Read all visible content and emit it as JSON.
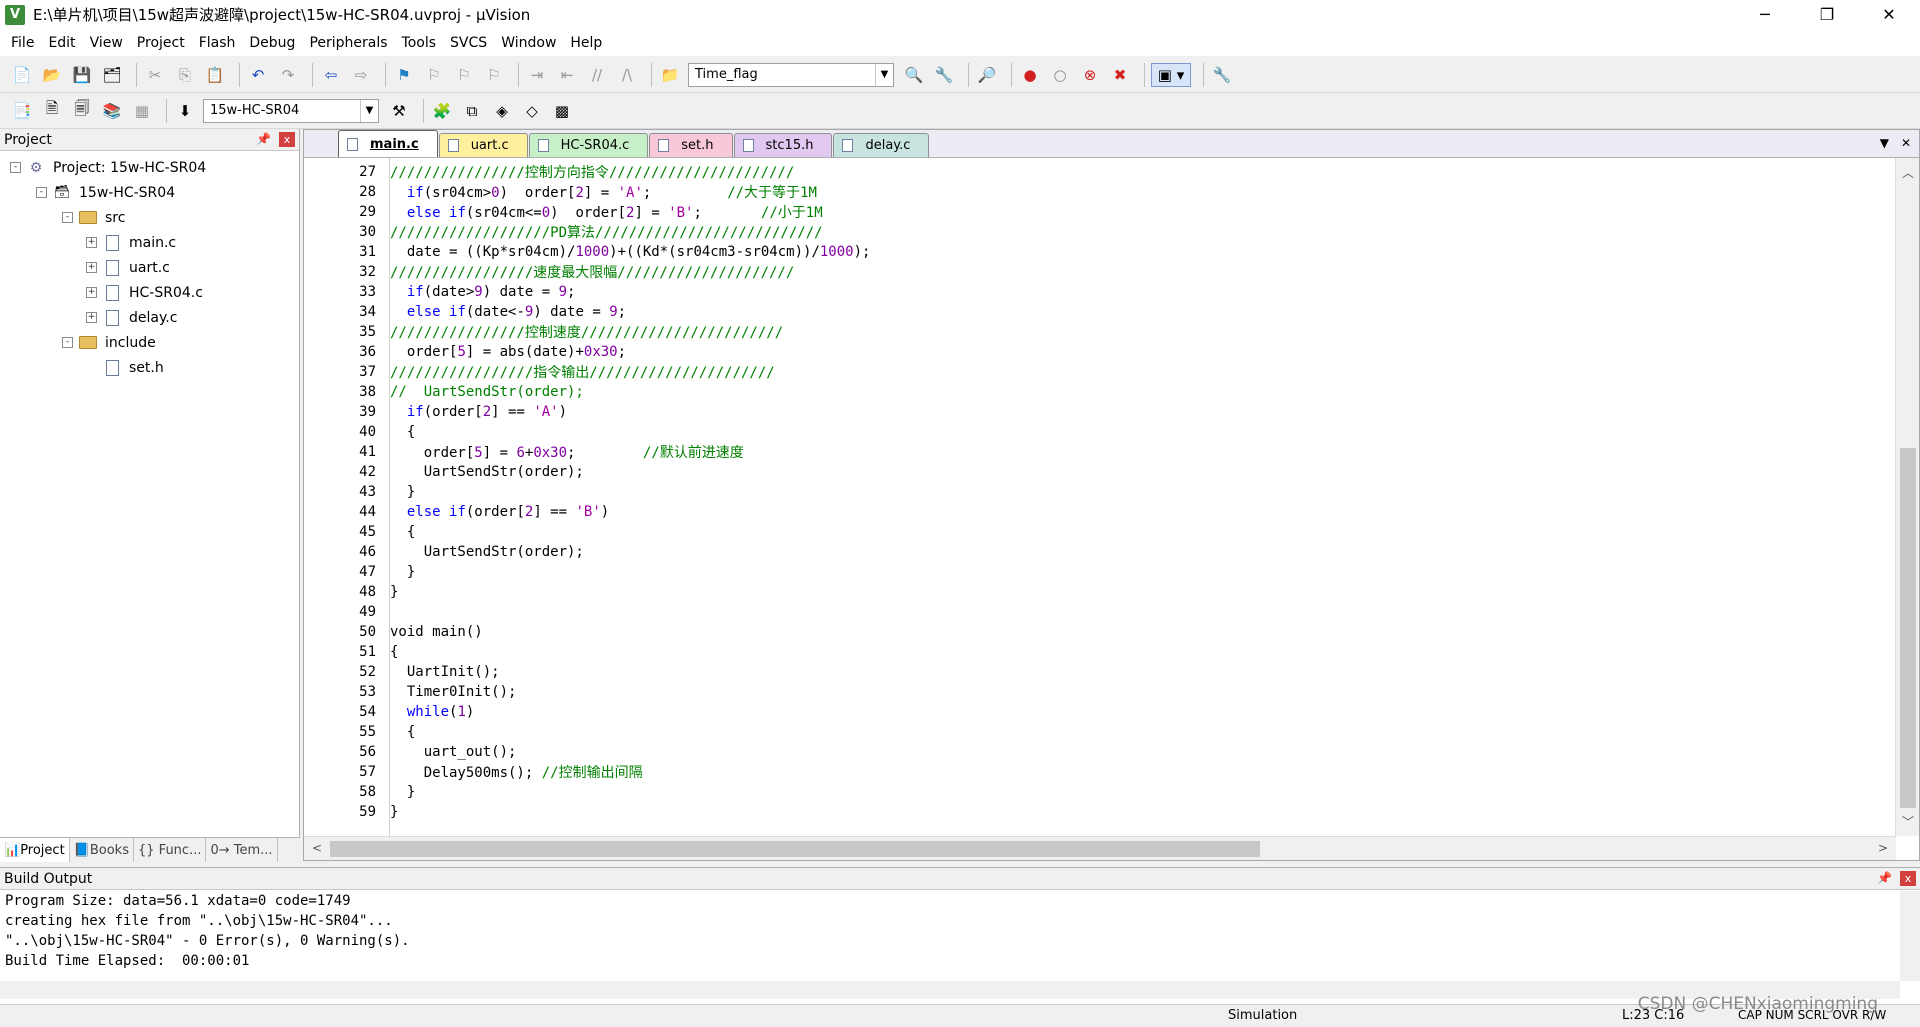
{
  "window": {
    "title": "E:\\单片机\\项目\\15w超声波避障\\project\\15w-HC-SR04.uvproj - µVision",
    "app_icon": "V",
    "minimize": "─",
    "restore": "❐",
    "close": "✕"
  },
  "menu": [
    "File",
    "Edit",
    "View",
    "Project",
    "Flash",
    "Debug",
    "Peripherals",
    "Tools",
    "SVCS",
    "Window",
    "Help"
  ],
  "toolbar1": {
    "find_combo_value": "Time_flag"
  },
  "toolbar2": {
    "target_combo_value": "15w-HC-SR04"
  },
  "project_panel": {
    "header": "Project",
    "pin": "📌",
    "close": "x",
    "root": "Project: 15w-HC-SR04",
    "target": "15w-HC-SR04",
    "groups": [
      {
        "name": "src",
        "files": [
          "main.c",
          "uart.c",
          "HC-SR04.c",
          "delay.c"
        ]
      },
      {
        "name": "include",
        "files": [
          "set.h"
        ]
      }
    ],
    "tabs": [
      "Project",
      "Books",
      "{} Func...",
      "0→ Tem..."
    ]
  },
  "editor": {
    "tabs": [
      {
        "label": "main.c",
        "active": true,
        "color": "#ffffff"
      },
      {
        "label": "uart.c",
        "active": false,
        "color": "#fff0a0"
      },
      {
        "label": "HC-SR04.c",
        "active": false,
        "color": "#c8f0c8"
      },
      {
        "label": "set.h",
        "active": false,
        "color": "#f8c8d8"
      },
      {
        "label": "stc15.h",
        "active": false,
        "color": "#e0c8f0"
      },
      {
        "label": "delay.c",
        "active": false,
        "color": "#c8e4e0"
      }
    ],
    "lines": [
      {
        "n": "27",
        "t": "////////////////控制方向指令//////////////////////"
      },
      {
        "n": "28",
        "t": "  if(sr04cm>0)  order[2] = 'A';         //大于等于1M"
      },
      {
        "n": "29",
        "t": "  else if(sr04cm<=0)  order[2] = 'B';       //小于1M"
      },
      {
        "n": "30",
        "t": "///////////////////PD算法///////////////////////////"
      },
      {
        "n": "31",
        "t": "  date = ((Kp*sr04cm)/1000)+((Kd*(sr04cm3-sr04cm))/1000);"
      },
      {
        "n": "32",
        "t": "/////////////////速度最大限幅/////////////////////"
      },
      {
        "n": "33",
        "t": "  if(date>9) date = 9;"
      },
      {
        "n": "34",
        "t": "  else if(date<-9) date = 9;"
      },
      {
        "n": "35",
        "t": "////////////////控制速度////////////////////////"
      },
      {
        "n": "36",
        "t": "  order[5] = abs(date)+0x30;"
      },
      {
        "n": "37",
        "t": "/////////////////指令输出//////////////////////"
      },
      {
        "n": "38",
        "t": "//  UartSendStr(order);"
      },
      {
        "n": "39",
        "t": "  if(order[2] == 'A')"
      },
      {
        "n": "40",
        "t": "  {"
      },
      {
        "n": "41",
        "t": "    order[5] = 6+0x30;        //默认前进速度"
      },
      {
        "n": "42",
        "t": "    UartSendStr(order);"
      },
      {
        "n": "43",
        "t": "  }"
      },
      {
        "n": "44",
        "t": "  else if(order[2] == 'B')"
      },
      {
        "n": "45",
        "t": "  {"
      },
      {
        "n": "46",
        "t": "    UartSendStr(order);"
      },
      {
        "n": "47",
        "t": "  }"
      },
      {
        "n": "48",
        "t": "}"
      },
      {
        "n": "49",
        "t": ""
      },
      {
        "n": "50",
        "t": "void main()"
      },
      {
        "n": "51",
        "t": "{"
      },
      {
        "n": "52",
        "t": "  UartInit();"
      },
      {
        "n": "53",
        "t": "  Timer0Init();"
      },
      {
        "n": "54",
        "t": "  while(1)"
      },
      {
        "n": "55",
        "t": "  {"
      },
      {
        "n": "56",
        "t": "    uart_out();"
      },
      {
        "n": "57",
        "t": "    Delay500ms(); //控制输出间隔"
      },
      {
        "n": "58",
        "t": "  }"
      },
      {
        "n": "59",
        "t": "}"
      }
    ]
  },
  "build_output": {
    "header": "Build Output",
    "lines": [
      "Program Size: data=56.1 xdata=0 code=1749",
      "creating hex file from \"..\\obj\\15w-HC-SR04\"...",
      "\"..\\obj\\15w-HC-SR04\" - 0 Error(s), 0 Warning(s).",
      "Build Time Elapsed:  00:00:01"
    ]
  },
  "status": {
    "mode": "Simulation",
    "position": "L:23 C:16",
    "flags": "CAP  NUM  SCRL  OVR  R/W"
  },
  "watermark": "CSDN @CHENxiaomingming"
}
